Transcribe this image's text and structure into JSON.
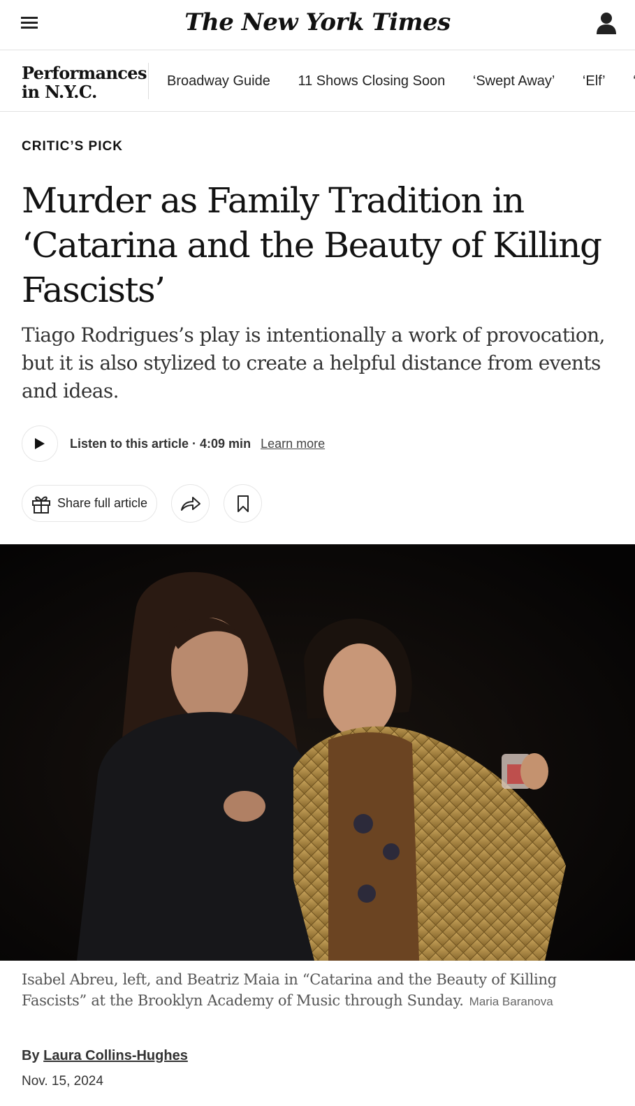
{
  "header": {
    "logo": "The New York Times",
    "menu_icon": "hamburger-menu-icon",
    "account_icon": "user-account-icon"
  },
  "section_nav": {
    "title": "Performances in N.Y.C.",
    "links": [
      "Broadway Guide",
      "11 Shows Closing Soon",
      "‘Swept Away’",
      "‘Elf’",
      "‘"
    ]
  },
  "article": {
    "kicker": "CRITIC’S PICK",
    "headline": "Murder as Family Tradition in ‘Catarina and the Beauty of Killing Fascists’",
    "dek": "Tiago Rodrigues’s play is intentionally a work of provocation, but it is also stylized to create a helpful distance from events and ideas.",
    "listen": {
      "label": "Listen to this article · 4:09 min",
      "learn_more": "Learn more"
    },
    "share": {
      "share_full": "Share full article"
    },
    "photo": {
      "caption": "Isabel Abreu, left, and Beatriz Maia in “Catarina and the Beauty of Killing Fascists” at the Brooklyn Academy of Music through Sunday.",
      "credit": "Maria Baranova"
    },
    "byline_prefix": "By",
    "author": "Laura Collins-Hughes",
    "date": "Nov. 15, 2024"
  }
}
